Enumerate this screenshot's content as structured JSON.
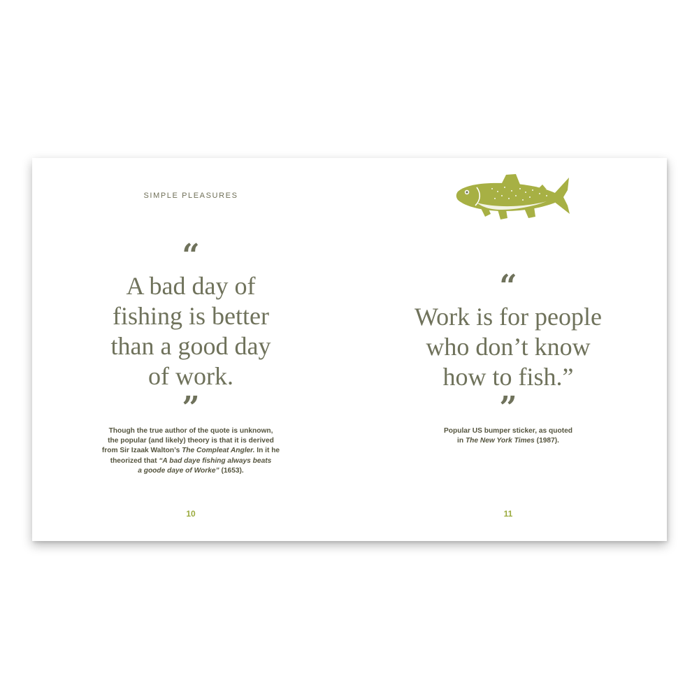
{
  "left_page": {
    "running_head": "SIMPLE PLEASURES",
    "open_quote": "“",
    "quote_lines": [
      "A bad day of",
      "fishing is better",
      "than a good day",
      "of work."
    ],
    "close_quote": "”",
    "note": {
      "line1": "Though the true author of the quote is unknown,",
      "line2": "the popular (and likely) theory is that it is derived",
      "line3_a": "from Sir Izaak Walton’s ",
      "line3_b": "The Compleat Angler.",
      "line3_c": " In it he",
      "line4_a": "theorized that ",
      "line4_b": "“A bad daye fishing always beats",
      "line5_a": "a goode daye of Worke”",
      "line5_b": " (1653)."
    },
    "page_number": "10"
  },
  "right_page": {
    "illustration_icon": "trout-fish-icon",
    "open_quote": "“",
    "quote_lines": [
      "Work is for people",
      "who don’t know",
      "how to fish.”"
    ],
    "close_quote": "”",
    "note": {
      "line1": "Popular US bumper sticker, as quoted",
      "line2_a": "in ",
      "line2_b": "The New York Times",
      "line2_c": " (1987)."
    },
    "page_number": "11"
  },
  "colors": {
    "quote_text": "#6f725b",
    "note_text": "#55553f",
    "page_number": "#9bab3f",
    "fish": "#a7b044"
  }
}
